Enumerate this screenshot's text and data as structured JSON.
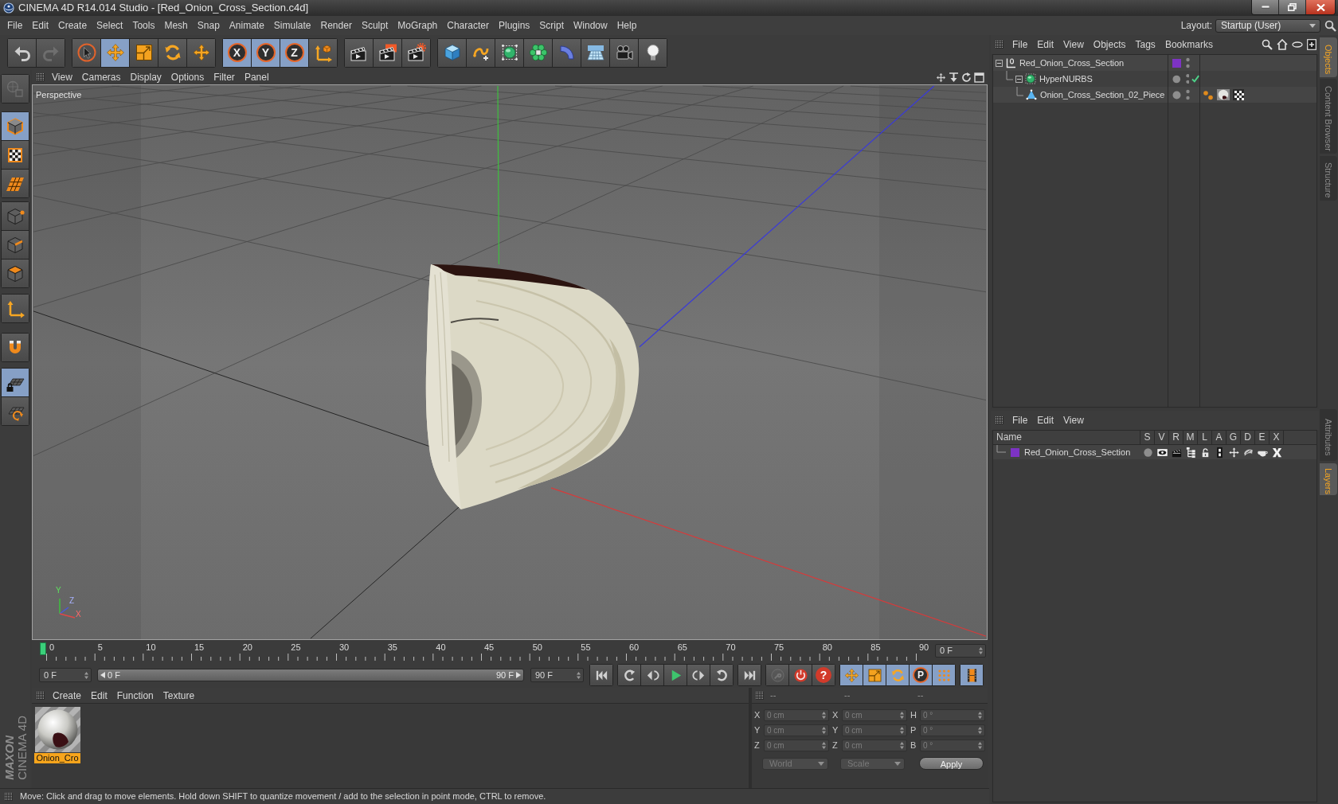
{
  "window": {
    "title": "CINEMA 4D R14.014 Studio - [Red_Onion_Cross_Section.c4d]"
  },
  "menu_bar": {
    "items": [
      "File",
      "Edit",
      "Create",
      "Select",
      "Tools",
      "Mesh",
      "Snap",
      "Animate",
      "Simulate",
      "Render",
      "Sculpt",
      "MoGraph",
      "Character",
      "Plugins",
      "Script",
      "Window",
      "Help"
    ],
    "layout_label": "Layout:",
    "layout_value": "Startup (User)"
  },
  "toolbar": {
    "groups": [
      [
        {
          "selected": false,
          "disabled": false
        },
        {
          "selected": false,
          "disabled": true
        }
      ],
      [
        {
          "selected": false,
          "disabled": false
        },
        {
          "selected": true,
          "disabled": false
        },
        {
          "selected": false,
          "disabled": false
        },
        {
          "selected": false,
          "disabled": false
        },
        {
          "selected": false,
          "disabled": false
        }
      ],
      [
        {
          "label": "X",
          "selected": true,
          "disabled": false
        },
        {
          "label": "Y",
          "selected": true,
          "disabled": false
        },
        {
          "label": "Z",
          "selected": true,
          "disabled": false
        },
        {
          "selected": false,
          "disabled": false
        }
      ],
      [
        {
          "selected": false,
          "disabled": false
        },
        {
          "selected": false,
          "disabled": false
        },
        {
          "selected": false,
          "disabled": false
        }
      ],
      [
        {
          "selected": false,
          "disabled": false
        },
        {
          "selected": false,
          "disabled": false
        },
        {
          "selected": false,
          "disabled": false
        },
        {
          "selected": false,
          "disabled": false
        },
        {
          "selected": false,
          "disabled": false
        },
        {
          "selected": false,
          "disabled": false
        },
        {
          "selected": false,
          "disabled": false
        },
        {
          "selected": false,
          "disabled": false
        }
      ]
    ]
  },
  "left_toolbar": {
    "groups": [
      [
        {
          "selected": false,
          "disabled": true
        }
      ],
      [
        {
          "selected": true,
          "disabled": false
        },
        {
          "selected": false,
          "disabled": false
        },
        {
          "selected": false,
          "disabled": false
        }
      ],
      [
        {
          "selected": false,
          "disabled": false
        },
        {
          "selected": false,
          "disabled": false
        },
        {
          "selected": false,
          "disabled": false
        }
      ],
      [
        {
          "selected": false,
          "disabled": false
        }
      ],
      [
        {
          "selected": false,
          "disabled": false
        }
      ],
      [
        {
          "selected": true,
          "disabled": false
        },
        {
          "selected": false,
          "disabled": false
        }
      ]
    ]
  },
  "viewport": {
    "menu": [
      "View",
      "Cameras",
      "Display",
      "Options",
      "Filter",
      "Panel"
    ],
    "camera_label": "Perspective",
    "axis_labels": [
      "Y",
      "Z",
      "X"
    ]
  },
  "objects_manager": {
    "menu": [
      "File",
      "Edit",
      "View",
      "Objects",
      "Tags",
      "Bookmarks"
    ],
    "tree": [
      {
        "name": "Red_Onion_Cross_Section",
        "kind": "null",
        "color": "#7d33c4",
        "expanded": true,
        "children": [
          {
            "name": "HyperNURBS",
            "kind": "generator",
            "enabled": true,
            "expanded": true,
            "children": [
              {
                "name": "Onion_Cross_Section_02_Piece",
                "kind": "polygon",
                "tags": [
                  {
                    "kind": "phong"
                  },
                  {
                    "kind": "material"
                  },
                  {
                    "kind": "uvw"
                  }
                ]
              }
            ]
          }
        ]
      }
    ]
  },
  "side_tabs": {
    "top": [
      {
        "label": "Objects",
        "selected": true
      },
      {
        "label": "Content Browser",
        "selected": false
      },
      {
        "label": "Structure",
        "selected": false
      }
    ],
    "bottom": [
      {
        "label": "Attributes",
        "selected": false
      },
      {
        "label": "Layers",
        "selected": true
      }
    ]
  },
  "layers_manager": {
    "menu": [
      "File",
      "Edit",
      "View"
    ],
    "columns": [
      "Name",
      "S",
      "V",
      "R",
      "M",
      "L",
      "A",
      "G",
      "D",
      "E",
      "X"
    ],
    "layers": [
      {
        "name": "Red_Onion_Cross_Section",
        "color": "#7d33c4",
        "flags": [
          {
            "on": false
          },
          {
            "on": true
          },
          {
            "on": true
          },
          {
            "on": true
          },
          {
            "on": false
          },
          {
            "on": true
          },
          {
            "on": true
          },
          {
            "on": true
          },
          {
            "on": true
          },
          {
            "on": true
          }
        ]
      }
    ]
  },
  "timeline": {
    "ticks": [
      "0",
      "5",
      "10",
      "15",
      "20",
      "25",
      "30",
      "35",
      "40",
      "45",
      "50",
      "55",
      "60",
      "65",
      "70",
      "75",
      "80",
      "85",
      "90"
    ],
    "level": 0,
    "current_frame": "0 F"
  },
  "transport": {
    "start_frame": "0 F",
    "range": {
      "start": "0 F",
      "end": "90 F",
      "level": 1
    },
    "end_frame": "90 F",
    "groups": [
      [
        {
          "selected": false,
          "disabled": false
        }
      ],
      [
        {
          "selected": false,
          "disabled": false
        },
        {
          "selected": false,
          "disabled": false
        },
        {
          "selected": false,
          "disabled": false
        },
        {
          "selected": false,
          "disabled": false
        },
        {
          "selected": false,
          "disabled": false
        }
      ],
      [
        {
          "selected": false,
          "disabled": false
        }
      ],
      [
        {
          "selected": false,
          "disabled": true
        },
        {
          "selected": false,
          "disabled": false
        },
        {
          "label": "?",
          "selected": false,
          "disabled": false
        }
      ],
      [
        {
          "selected": true,
          "disabled": false
        },
        {
          "selected": true,
          "disabled": false
        },
        {
          "selected": true,
          "disabled": false
        },
        {
          "label": "P",
          "selected": true,
          "disabled": false
        },
        {
          "selected": true,
          "disabled": false
        }
      ],
      [
        {
          "selected": true,
          "disabled": false
        }
      ]
    ]
  },
  "material_manager": {
    "menu": [
      "Create",
      "Edit",
      "Function",
      "Texture"
    ],
    "materials": [
      {
        "name": "Onion_Cro",
        "selected": true
      }
    ]
  },
  "coordinates": {
    "disabled": true,
    "headers": [
      "--",
      "--",
      "--"
    ],
    "rows": [
      [
        {
          "label": "X",
          "value": "0 cm"
        },
        {
          "label": "X",
          "value": "0 cm"
        },
        {
          "label": "H",
          "value": "0 °"
        }
      ],
      [
        {
          "label": "Y",
          "value": "0 cm"
        },
        {
          "label": "Y",
          "value": "0 cm"
        },
        {
          "label": "P",
          "value": "0 °"
        }
      ],
      [
        {
          "label": "Z",
          "value": "0 cm"
        },
        {
          "label": "Z",
          "value": "0 cm"
        },
        {
          "label": "B",
          "value": "0 °"
        }
      ]
    ],
    "coordinate_mode": "World",
    "transform_mode": "Scale",
    "apply_label": "Apply"
  },
  "logo": {
    "lines": [
      "MAXON",
      "CINEMA 4D"
    ]
  },
  "status_bar": {
    "text": "Move: Click and drag to move elements. Hold down SHIFT to quantize movement / add to the selection in point mode, CTRL to remove."
  }
}
